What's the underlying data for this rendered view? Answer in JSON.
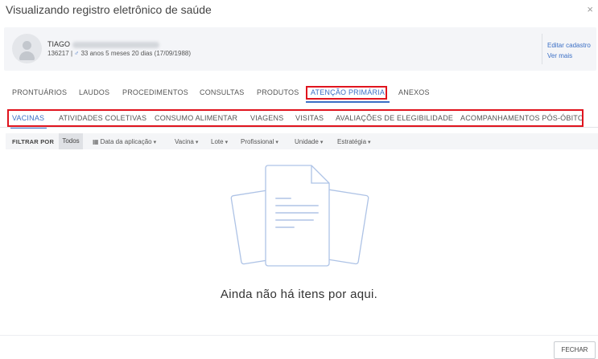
{
  "modal": {
    "title": "Visualizando registro eletrônico de saúde",
    "close_icon": "×"
  },
  "patient": {
    "name": "TIAGO",
    "id": "136217",
    "separator": "|",
    "sex_icon": "♂",
    "age_birth": "33 anos 5 meses 20 dias (17/09/1988)",
    "edit_link": "Editar cadastro",
    "more_link": "Ver mais"
  },
  "tabs": [
    {
      "label": "PRONTUÁRIOS"
    },
    {
      "label": "LAUDOS"
    },
    {
      "label": "PROCEDIMENTOS"
    },
    {
      "label": "CONSULTAS"
    },
    {
      "label": "PRODUTOS"
    },
    {
      "label": "ATENÇÃO PRIMÁRIA",
      "active": true,
      "highlighted": true
    },
    {
      "label": "ANEXOS"
    }
  ],
  "subtabs": [
    {
      "label": "VACINAS",
      "active": true
    },
    {
      "label": "ATIVIDADES COLETIVAS"
    },
    {
      "label": "CONSUMO ALIMENTAR"
    },
    {
      "label": "VIAGENS"
    },
    {
      "label": "VISITAS"
    },
    {
      "label": "AVALIAÇÕES DE ELEGIBILIDADE"
    },
    {
      "label": "ACOMPANHAMENTOS PÓS-ÓBITO"
    }
  ],
  "filters": {
    "label": "FILTRAR POR",
    "all": "Todos",
    "items": [
      {
        "label": "Data da aplicação",
        "icon": "calendar-icon"
      },
      {
        "label": "Vacina"
      },
      {
        "label": "Lote"
      },
      {
        "label": "Profissional"
      },
      {
        "label": "Unidade"
      },
      {
        "label": "Estratégia"
      }
    ],
    "chevron": "▾",
    "calendar_glyph": "▦"
  },
  "empty_state": {
    "message": "Ainda não há itens por aqui.",
    "icon": "empty-documents-illustration"
  },
  "footer": {
    "close_label": "FECHAR"
  },
  "colors": {
    "accent": "#3b6fc5",
    "highlight": "#e0141e",
    "card_bg": "#f4f5f8"
  }
}
